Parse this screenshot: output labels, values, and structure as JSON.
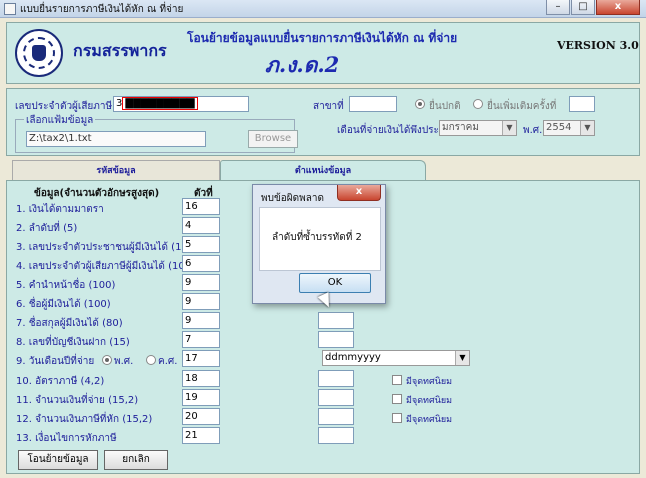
{
  "window": {
    "title": "แบบยื่นรายการภาษีเงินได้หัก ณ ที่จ่าย"
  },
  "header": {
    "org": "กรมสรรพากร",
    "title": "โอนย้ายข้อมูลแบบยื่นรายการภาษีเงินได้หัก ณ ที่จ่าย",
    "form": "ภ.ง.ด.2",
    "version": "VERSION 3.0"
  },
  "info": {
    "taxid_label": "เลขประจำตัวผู้เสียภาษี",
    "taxid_prefix": "3",
    "branch_label": "สาขาที่",
    "radio_normal": "ยื่นปกติ",
    "radio_additional": "ยื่นเพิ่มเติมครั้งที่",
    "file_group_label": "เลือกแฟ้มข้อมูล",
    "file_path": "Z:\\tax2\\1.txt",
    "browse_label": "Browse",
    "month_label": "เดือนที่จ่ายเงินได้พึงประเมิน",
    "month_value": "มกราคม",
    "year_label": "พ.ศ.",
    "year_value": "2554"
  },
  "tabs": [
    {
      "label": "รหัสข้อมูล"
    },
    {
      "label": "ตำแหน่งข้อมูล"
    }
  ],
  "table": {
    "col_item": "ข้อมูล(จำนวนตัวอักษรสูงสุด)",
    "col_pos": "ตัวที่",
    "rows": [
      {
        "label": "1. เงินได้ตามมาตรา",
        "pos": "16"
      },
      {
        "label": "2. ลำดับที่ (5)",
        "pos": "4"
      },
      {
        "label": "3. เลขประจำตัวประชาชนผู้มีเงินได้ (13)",
        "pos": "5"
      },
      {
        "label": "4. เลขประจำตัวผู้เสียภาษีผู้มีเงินได้ (10)",
        "pos": "6"
      },
      {
        "label": "5. คำนำหน้าชื่อ (100)",
        "pos": "9"
      },
      {
        "label": "6. ชื่อผู้มีเงินได้ (100)",
        "pos": "9"
      },
      {
        "label": "7. ชื่อสกุลผู้มีเงินได้ (80)",
        "pos": "9"
      },
      {
        "label": "8. เลขที่บัญชีเงินฝาก (15)",
        "pos": "7"
      },
      {
        "label": "9. วันเดือนปีที่จ่าย",
        "pos": "17"
      },
      {
        "label": "10. อัตราภาษี (4,2)",
        "pos": "18"
      },
      {
        "label": "11. จำนวนเงินที่จ่าย (15,2)",
        "pos": "19"
      },
      {
        "label": "12. จำนวนเงินภาษีที่หัก (15,2)",
        "pos": "20"
      },
      {
        "label": "13. เงื่อนไขการหักภาษี",
        "pos": "21"
      }
    ],
    "radio_be": "พ.ศ.",
    "radio_ce": "ค.ศ.",
    "date_format": "ddmmyyyy",
    "decimal_label": "มีจุดทศนิยม"
  },
  "buttons": {
    "transfer": "โอนย้ายข้อมูล",
    "cancel": "ยกเลิก"
  },
  "dialog": {
    "title": "พบข้อผิดพลาด",
    "close": "x",
    "message": "ลำดับที่ซ้ำบรรทัดที่ 2",
    "ok": "OK"
  },
  "winctrl": {
    "min": "–",
    "max": "□",
    "close": "x"
  },
  "colors": {
    "panel": "#cdeae6",
    "accent": "#1d2ab0"
  }
}
